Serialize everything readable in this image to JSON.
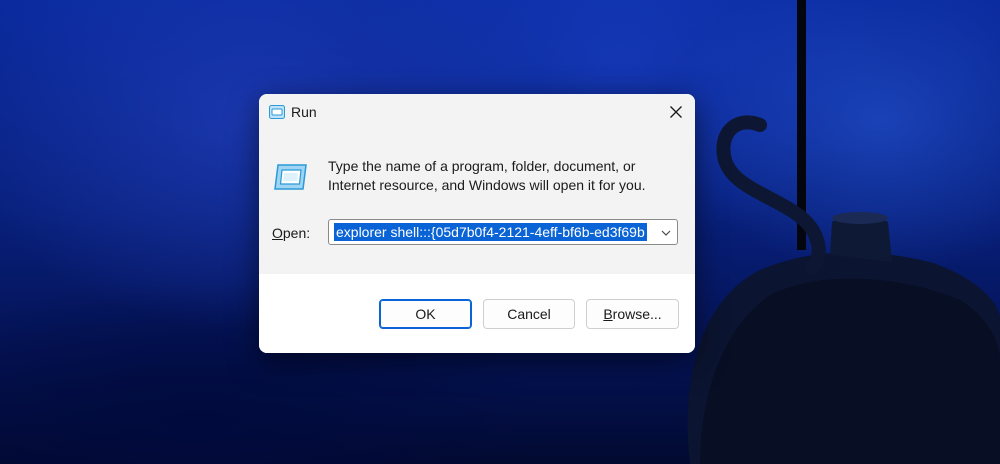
{
  "window": {
    "title": "Run"
  },
  "dialog": {
    "description_line1": "Type the name of a program, folder, document, or",
    "description_line2": "Internet resource, and Windows will open it for you.",
    "open_label_accel": "O",
    "open_label_rest": "pen:",
    "open_value": "explorer shell:::{05d7b0f4-2121-4eff-bf6b-ed3f69b"
  },
  "buttons": {
    "ok": "OK",
    "cancel": "Cancel",
    "browse_accel": "B",
    "browse_rest": "rowse..."
  },
  "icons": {
    "title_icon": "run-icon",
    "big_icon": "run-icon",
    "close": "close-icon",
    "dropdown": "chevron-down-icon"
  },
  "colors": {
    "selection": "#0a64d6",
    "default_button_border": "#0a64d6",
    "icon_blue": "#2a9ad8"
  }
}
